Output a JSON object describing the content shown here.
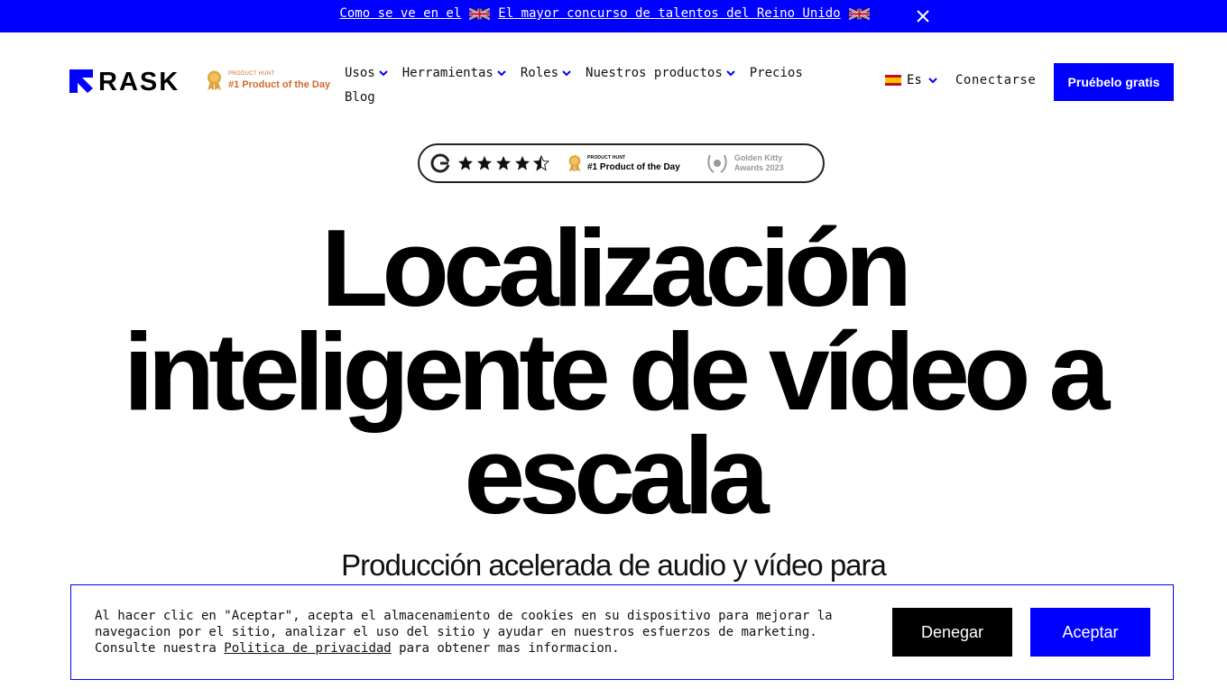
{
  "announcement": {
    "prefix": "Como se ve en el",
    "link": "El mayor concurso de talentos del Reino Unido",
    "flag_icon": "uk-flag-icon",
    "close_icon": "close-icon"
  },
  "header": {
    "logo_text": "RASK",
    "product_hunt": {
      "small": "PRODUCT HUNT",
      "big": "#1 Product of the Day"
    },
    "nav": {
      "row1": [
        {
          "label": "Usos",
          "dropdown": true
        },
        {
          "label": "Herramientas",
          "dropdown": true
        },
        {
          "label": "Roles",
          "dropdown": true
        },
        {
          "label": "Nuestros productos",
          "dropdown": true
        },
        {
          "label": "Precios",
          "dropdown": false
        }
      ],
      "row2": [
        {
          "label": "Blog",
          "dropdown": false
        }
      ]
    },
    "language": "Es",
    "login": "Conectarse",
    "cta": "Pruébelo gratis"
  },
  "awards": {
    "g2_rating_stars": 4.5,
    "product_hunt_small": "PRODUCT HUNT",
    "product_hunt_big": "#1 Product of the Day",
    "kitty_line1": "Golden Kitty",
    "kitty_line2": "Awards 2023"
  },
  "hero": {
    "title_line1": "Localización",
    "title_line2": "inteligente de vídeo a",
    "title_line3": "escala",
    "subtitle": "Producción acelerada de audio y vídeo para"
  },
  "cookie": {
    "text_before": "Al hacer clic en \"Aceptar\", acepta el almacenamiento de cookies en su dispositivo para mejorar la navegacion por el sitio, analizar el uso del sitio y ayudar en nuestros esfuerzos de marketing. Consulte nuestra",
    "link": "Politica de privacidad",
    "text_after": "para obtener mas informacion.",
    "deny": "Denegar",
    "accept": "Aceptar"
  },
  "colors": {
    "brand_blue": "#0000ff",
    "black": "#000000",
    "white": "#ffffff"
  }
}
